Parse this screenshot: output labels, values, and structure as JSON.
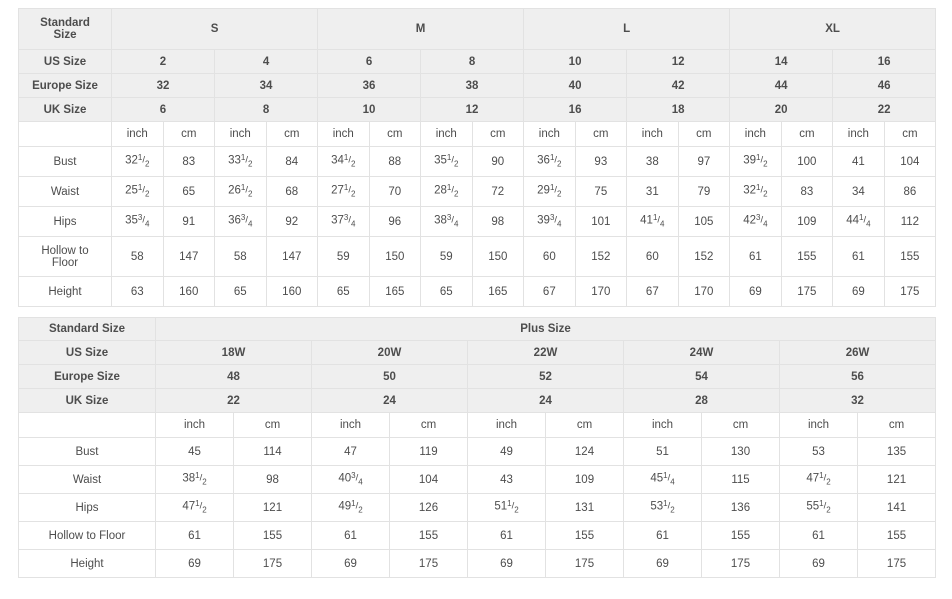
{
  "standard_table": {
    "corner_label": "Standard\nSize",
    "corner_label_line1": "Standard",
    "corner_label_line2": "Size",
    "size_groups": [
      {
        "label": "S",
        "span": 4
      },
      {
        "label": "M",
        "span": 4
      },
      {
        "label": "L",
        "span": 4
      },
      {
        "label": "XL",
        "span": 4
      }
    ],
    "size_rows": [
      {
        "label": "US Size",
        "values": [
          "2",
          "4",
          "6",
          "8",
          "10",
          "12",
          "14",
          "16"
        ]
      },
      {
        "label": "Europe Size",
        "values": [
          "32",
          "34",
          "36",
          "38",
          "40",
          "42",
          "44",
          "46"
        ]
      },
      {
        "label": "UK Size",
        "values": [
          "6",
          "8",
          "10",
          "12",
          "16",
          "18",
          "20",
          "22"
        ]
      }
    ],
    "unit_row": {
      "label": "",
      "units": [
        "inch",
        "cm",
        "inch",
        "cm",
        "inch",
        "cm",
        "inch",
        "cm",
        "inch",
        "cm",
        "inch",
        "cm",
        "inch",
        "cm",
        "inch",
        "cm"
      ]
    },
    "measure_rows": [
      {
        "label": "Bust",
        "label_line1": "Bust",
        "label_line2": "",
        "values": [
          {
            "whole": "32",
            "num": "1",
            "den": "2"
          },
          {
            "whole": "83"
          },
          {
            "whole": "33",
            "num": "1",
            "den": "2"
          },
          {
            "whole": "84"
          },
          {
            "whole": "34",
            "num": "1",
            "den": "2"
          },
          {
            "whole": "88"
          },
          {
            "whole": "35",
            "num": "1",
            "den": "2"
          },
          {
            "whole": "90"
          },
          {
            "whole": "36",
            "num": "1",
            "den": "2"
          },
          {
            "whole": "93"
          },
          {
            "whole": "38"
          },
          {
            "whole": "97"
          },
          {
            "whole": "39",
            "num": "1",
            "den": "2"
          },
          {
            "whole": "100"
          },
          {
            "whole": "41"
          },
          {
            "whole": "104"
          }
        ]
      },
      {
        "label": "Waist",
        "label_line1": "Waist",
        "label_line2": "",
        "values": [
          {
            "whole": "25",
            "num": "1",
            "den": "2"
          },
          {
            "whole": "65"
          },
          {
            "whole": "26",
            "num": "1",
            "den": "2"
          },
          {
            "whole": "68"
          },
          {
            "whole": "27",
            "num": "1",
            "den": "2"
          },
          {
            "whole": "70"
          },
          {
            "whole": "28",
            "num": "1",
            "den": "2"
          },
          {
            "whole": "72"
          },
          {
            "whole": "29",
            "num": "1",
            "den": "2"
          },
          {
            "whole": "75"
          },
          {
            "whole": "31"
          },
          {
            "whole": "79"
          },
          {
            "whole": "32",
            "num": "1",
            "den": "2"
          },
          {
            "whole": "83"
          },
          {
            "whole": "34"
          },
          {
            "whole": "86"
          }
        ]
      },
      {
        "label": "Hips",
        "label_line1": "Hips",
        "label_line2": "",
        "values": [
          {
            "whole": "35",
            "num": "3",
            "den": "4"
          },
          {
            "whole": "91"
          },
          {
            "whole": "36",
            "num": "3",
            "den": "4"
          },
          {
            "whole": "92"
          },
          {
            "whole": "37",
            "num": "3",
            "den": "4"
          },
          {
            "whole": "96"
          },
          {
            "whole": "38",
            "num": "3",
            "den": "4"
          },
          {
            "whole": "98"
          },
          {
            "whole": "39",
            "num": "3",
            "den": "4"
          },
          {
            "whole": "101"
          },
          {
            "whole": "41",
            "num": "1",
            "den": "4"
          },
          {
            "whole": "105"
          },
          {
            "whole": "42",
            "num": "3",
            "den": "4"
          },
          {
            "whole": "109"
          },
          {
            "whole": "44",
            "num": "1",
            "den": "4"
          },
          {
            "whole": "112"
          }
        ]
      },
      {
        "label": "Hollow to Floor",
        "label_line1": "Hollow to",
        "label_line2": "Floor",
        "values": [
          {
            "whole": "58"
          },
          {
            "whole": "147"
          },
          {
            "whole": "58"
          },
          {
            "whole": "147"
          },
          {
            "whole": "59"
          },
          {
            "whole": "150"
          },
          {
            "whole": "59"
          },
          {
            "whole": "150"
          },
          {
            "whole": "60"
          },
          {
            "whole": "152"
          },
          {
            "whole": "60"
          },
          {
            "whole": "152"
          },
          {
            "whole": "61"
          },
          {
            "whole": "155"
          },
          {
            "whole": "61"
          },
          {
            "whole": "155"
          }
        ]
      },
      {
        "label": "Height",
        "label_line1": "Height",
        "label_line2": "",
        "values": [
          {
            "whole": "63"
          },
          {
            "whole": "160"
          },
          {
            "whole": "65"
          },
          {
            "whole": "160"
          },
          {
            "whole": "65"
          },
          {
            "whole": "165"
          },
          {
            "whole": "65"
          },
          {
            "whole": "165"
          },
          {
            "whole": "67"
          },
          {
            "whole": "170"
          },
          {
            "whole": "67"
          },
          {
            "whole": "170"
          },
          {
            "whole": "69"
          },
          {
            "whole": "175"
          },
          {
            "whole": "69"
          },
          {
            "whole": "175"
          }
        ]
      }
    ]
  },
  "plus_table": {
    "corner_label": "Standard Size",
    "group_label": "Plus Size",
    "size_rows": [
      {
        "label": "US Size",
        "values": [
          "18W",
          "20W",
          "22W",
          "24W",
          "26W"
        ]
      },
      {
        "label": "Europe Size",
        "values": [
          "48",
          "50",
          "52",
          "54",
          "56"
        ]
      },
      {
        "label": "UK Size",
        "values": [
          "22",
          "24",
          "24",
          "28",
          "32"
        ]
      }
    ],
    "unit_row": {
      "label": "",
      "units": [
        "inch",
        "cm",
        "inch",
        "cm",
        "inch",
        "cm",
        "inch",
        "cm",
        "inch",
        "cm"
      ]
    },
    "measure_rows": [
      {
        "label": "Bust",
        "values": [
          {
            "whole": "45"
          },
          {
            "whole": "114"
          },
          {
            "whole": "47"
          },
          {
            "whole": "119"
          },
          {
            "whole": "49"
          },
          {
            "whole": "124"
          },
          {
            "whole": "51"
          },
          {
            "whole": "130"
          },
          {
            "whole": "53"
          },
          {
            "whole": "135"
          }
        ]
      },
      {
        "label": "Waist",
        "values": [
          {
            "whole": "38",
            "num": "1",
            "den": "2"
          },
          {
            "whole": "98"
          },
          {
            "whole": "40",
            "num": "3",
            "den": "4"
          },
          {
            "whole": "104"
          },
          {
            "whole": "43"
          },
          {
            "whole": "109"
          },
          {
            "whole": "45",
            "num": "1",
            "den": "4"
          },
          {
            "whole": "115"
          },
          {
            "whole": "47",
            "num": "1",
            "den": "2"
          },
          {
            "whole": "121"
          }
        ]
      },
      {
        "label": "Hips",
        "values": [
          {
            "whole": "47",
            "num": "1",
            "den": "2"
          },
          {
            "whole": "121"
          },
          {
            "whole": "49",
            "num": "1",
            "den": "2"
          },
          {
            "whole": "126"
          },
          {
            "whole": "51",
            "num": "1",
            "den": "2"
          },
          {
            "whole": "131"
          },
          {
            "whole": "53",
            "num": "1",
            "den": "2"
          },
          {
            "whole": "136"
          },
          {
            "whole": "55",
            "num": "1",
            "den": "2"
          },
          {
            "whole": "141"
          }
        ]
      },
      {
        "label": "Hollow to Floor",
        "values": [
          {
            "whole": "61"
          },
          {
            "whole": "155"
          },
          {
            "whole": "61"
          },
          {
            "whole": "155"
          },
          {
            "whole": "61"
          },
          {
            "whole": "155"
          },
          {
            "whole": "61"
          },
          {
            "whole": "155"
          },
          {
            "whole": "61"
          },
          {
            "whole": "155"
          }
        ]
      },
      {
        "label": "Height",
        "values": [
          {
            "whole": "69"
          },
          {
            "whole": "175"
          },
          {
            "whole": "69"
          },
          {
            "whole": "175"
          },
          {
            "whole": "69"
          },
          {
            "whole": "175"
          },
          {
            "whole": "69"
          },
          {
            "whole": "175"
          },
          {
            "whole": "69"
          },
          {
            "whole": "175"
          }
        ]
      }
    ]
  },
  "colors": {
    "header_bg": "#efefef",
    "body_bg": "#ffffff",
    "border": "#e2e2e2",
    "header_text": "#2b2b2b",
    "body_text": "#4d4d4d"
  }
}
